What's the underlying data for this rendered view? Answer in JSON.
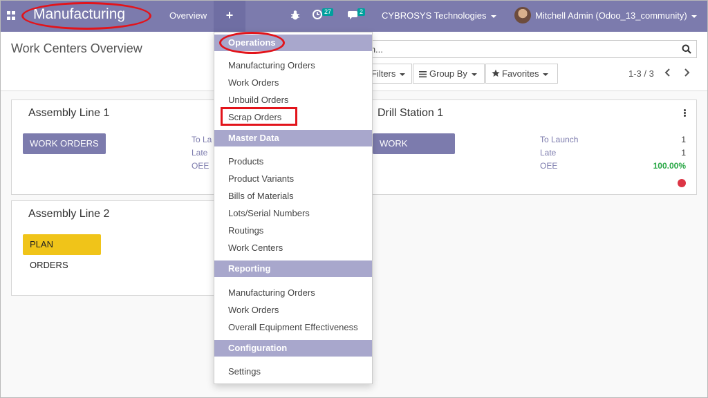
{
  "navbar": {
    "app_title": "Manufacturing",
    "overview_label": "Overview",
    "plus_label": "+",
    "activity_count": "27",
    "message_count": "2",
    "company": "CYBROSYS Technologies",
    "user": "Mitchell Admin (Odoo_13_community)"
  },
  "control_panel": {
    "title": "Work Centers Overview",
    "search_value": "rch...",
    "filters_label": "Filters",
    "groupby_label": "Group By",
    "favorites_label": "Favorites",
    "pager": "1-3 / 3"
  },
  "cards": {
    "assembly_line_1": {
      "title": "Assembly Line 1",
      "button": "WORK ORDERS",
      "labels": [
        "To La",
        "Late",
        "OEE"
      ]
    },
    "drill_station_1": {
      "title": "Drill Station 1",
      "button": "WORK ORDERS",
      "stats": [
        {
          "label": "To Launch",
          "value": "1"
        },
        {
          "label": "Late",
          "value": "1"
        },
        {
          "label": "OEE",
          "value": "100.00%"
        }
      ]
    },
    "assembly_line_2": {
      "title": "Assembly Line 2",
      "button": "PLAN ORDERS"
    }
  },
  "dropdown": {
    "operations_header": "Operations",
    "operations": [
      "Manufacturing Orders",
      "Work Orders",
      "Unbuild Orders",
      "Scrap Orders"
    ],
    "master_data_header": "Master Data",
    "master_data": [
      "Products",
      "Product Variants",
      "Bills of Materials",
      "Lots/Serial Numbers",
      "Routings",
      "Work Centers"
    ],
    "reporting_header": "Reporting",
    "reporting": [
      "Manufacturing Orders",
      "Work Orders",
      "Overall Equipment Effectiveness"
    ],
    "configuration_header": "Configuration",
    "configuration": [
      "Settings"
    ]
  },
  "colors": {
    "navbar": "#7c7bad",
    "menu_header": "#a8a7cc",
    "highlight": "#e2141b",
    "plan_orders": "#f0c419",
    "oee_green": "#28a745"
  },
  "icons": {
    "apps": "apps-grid-icon",
    "bug": "bug-icon",
    "activity": "clock-icon",
    "chat": "chat-icon",
    "search": "search-icon",
    "star": "star-icon",
    "groupby": "list-icon"
  }
}
